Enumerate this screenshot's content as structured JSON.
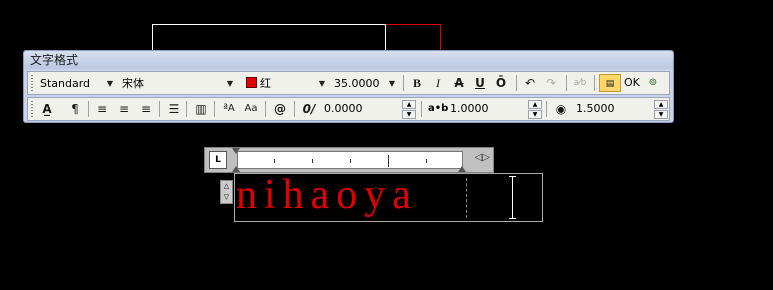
{
  "toolbar": {
    "title": "文字格式",
    "style": "Standard",
    "font": "宋体",
    "color_name": "红",
    "color_swatch": "#e00000",
    "height": "35.0000",
    "bold": "B",
    "italic": "I",
    "strike": "A",
    "underline": "U",
    "overline": "Ō",
    "ok": "OK",
    "oblique_value": "0.0000",
    "tracking_value": "1.0000",
    "width_value": "1.5000",
    "track_label": "a•b"
  },
  "ruler": {
    "tab_label": "L"
  },
  "editor": {
    "text": "nihaoya"
  },
  "colors": {
    "text_red": "#e00000",
    "toolbar_bg": "#c8d3e6"
  }
}
